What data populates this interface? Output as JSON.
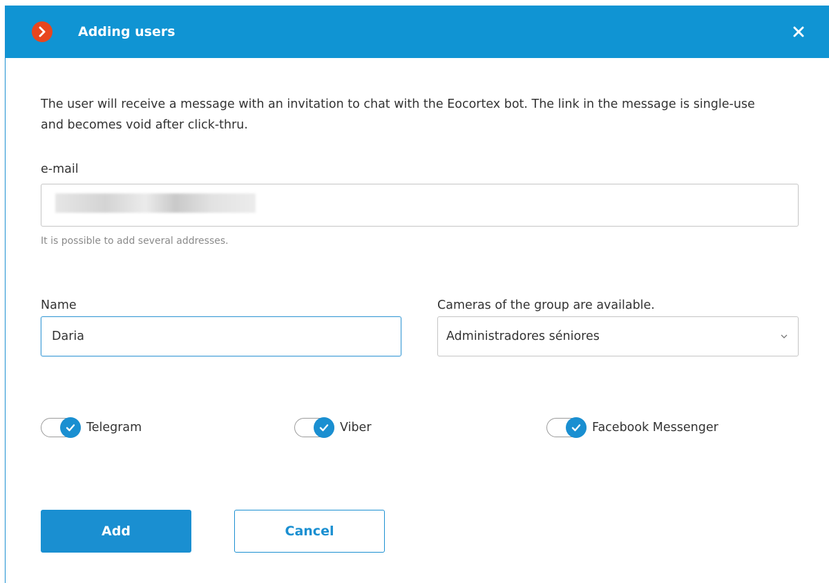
{
  "dialog": {
    "title": "Adding users",
    "description": "The user will receive a message with an invitation to chat with the Eocortex bot. The link in the message is single-use and becomes void after click-thru."
  },
  "email": {
    "label": "e-mail",
    "value": "",
    "hint": "It is possible to add several addresses."
  },
  "name": {
    "label": "Name",
    "value": "Daria"
  },
  "group": {
    "label": "Cameras of the group are available.",
    "selected": "Administradores séniores"
  },
  "toggles": [
    {
      "label": "Telegram",
      "checked": true
    },
    {
      "label": "Viber",
      "checked": true
    },
    {
      "label": "Facebook Messenger",
      "checked": true
    }
  ],
  "buttons": {
    "add": "Add",
    "cancel": "Cancel"
  },
  "colors": {
    "titlebar": "#1094d3",
    "accent": "#1a8fd1",
    "logo": "#e8461e"
  },
  "icons": {
    "logo": "chevron-right-logo-icon",
    "close": "close-icon",
    "dropdown": "chevron-down-icon",
    "check": "checkmark-icon"
  }
}
